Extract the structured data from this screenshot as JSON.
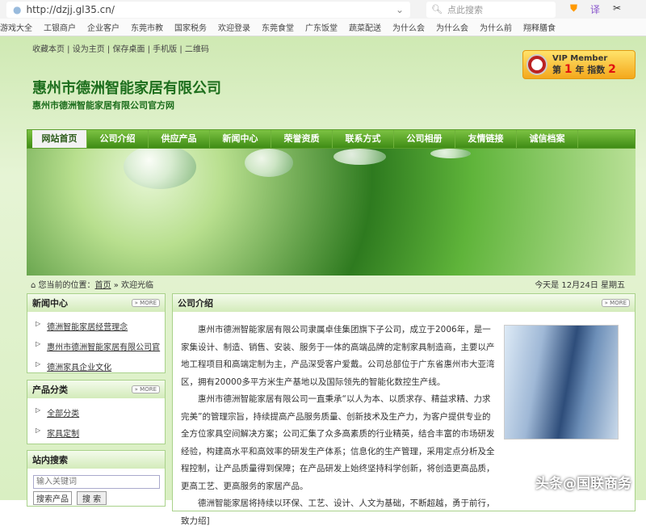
{
  "browser": {
    "url": "http://dzjj.gl35.cn/",
    "search_placeholder": "点此搜索",
    "tool_icons": [
      "shield",
      "translate",
      "scissors"
    ],
    "bookmarks": [
      "游戏大全",
      "工银商户",
      "企业客户",
      "东莞市教",
      "国家税务",
      "欢迎登录",
      "东莞食堂",
      "广东饭堂",
      "蔬菜配送",
      "为什么会",
      "为什么会",
      "为什么前",
      "翔释膳食"
    ]
  },
  "top_links": "收藏本页 | 设为主页 | 保存桌面 | 手机版 | 二维码",
  "vip": {
    "title": "VIP Member",
    "prefix": "第",
    "year": "1",
    "year_unit": "年",
    "index_label": "指数",
    "index": "2"
  },
  "site": {
    "title": "惠州市德洲智能家居有限公司",
    "subtitle": "惠州市德洲智能家居有限公司官方网"
  },
  "nav": [
    "网站首页",
    "公司介绍",
    "供应产品",
    "新闻中心",
    "荣誉资质",
    "联系方式",
    "公司相册",
    "友情链接",
    "诚信档案"
  ],
  "breadcrumb": {
    "prefix": "您当前的位置：",
    "home": "首页",
    "sep": "»",
    "current": "欢迎光临"
  },
  "date": "今天是 12月24日 星期五",
  "more": "» MORE",
  "news": {
    "title": "新闻中心",
    "items": [
      "德洲智能家居经营理念",
      "惠州市德洲智能家居有限公司官",
      "德洲家具企业文化"
    ]
  },
  "products": {
    "title": "产品分类",
    "items": [
      "全部分类",
      "家具定制"
    ]
  },
  "search": {
    "title": "站内搜索",
    "placeholder": "输入关键词",
    "select": "搜索产品",
    "button": "搜 索"
  },
  "intro": {
    "title": "公司介绍",
    "paragraphs": [
      "惠州市德洲智能家居有限公司隶属卓佳集团旗下子公司，成立于2006年，是一家集设计、制造、销售、安装、服务于一体的高端品牌的定制家具制造商，主要以产地工程项目和高端定制为主，产品深受客户爱戴。公司总部位于广东省惠州市大亚湾区，拥有20000多平方米生产基地以及国际领先的智能化数控生产线。",
      "惠州市德洲智能家居有限公司一直秉承“以人为本、以质求存、精益求精、力求完美”的管理宗旨，持续提高产品服务质量、创新技术及生产力，为客户提供专业的全方位家具空间解决方案；公司汇集了众多高素质的行业精英，结合丰富的市场研发经验，构建高水平和高效率的研发生产体系；信息化的生产管理，采用定点分析及全程控制，让产品质量得到保障；在产品研发上始终坚持科学创新，将创造更高品质，更高工艺、更高服务的家居产品。",
      "德洲智能家居将持续以环保、工艺、设计、人文为基础，不断超越，勇于前行，致力绍]"
    ]
  },
  "watermark": "头条@国联商务"
}
